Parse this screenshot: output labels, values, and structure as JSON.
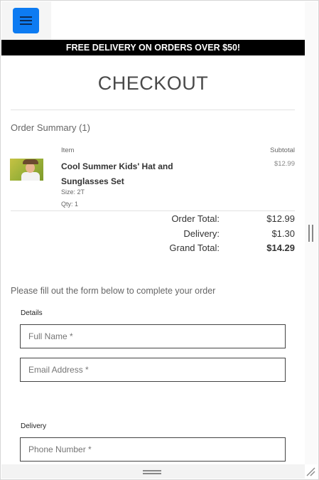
{
  "header": {
    "menu_icon": "hamburger-menu-icon",
    "promo_text": "FREE DELIVERY ON ORDERS OVER $50!",
    "accent_color": "#0d7bf2"
  },
  "page": {
    "title": "CHECKOUT"
  },
  "order_summary": {
    "title": "Order Summary (1)",
    "columns": {
      "item": "Item",
      "subtotal": "Subtotal"
    },
    "items": [
      {
        "name": "Cool Summer Kids' Hat and Sunglasses Set",
        "price": "$12.99",
        "size": "Size: 2T",
        "qty": "Qty: 1"
      }
    ],
    "totals": [
      {
        "label": "Order Total:",
        "value": "$12.99"
      },
      {
        "label": "Delivery:",
        "value": "$1.30"
      },
      {
        "label": "Grand Total:",
        "value": "$14.29"
      }
    ]
  },
  "form": {
    "instructions": "Please fill out the form below to complete your order",
    "details_label": "Details",
    "full_name_placeholder": "Full Name *",
    "email_placeholder": "Email Address *",
    "delivery_label": "Delivery",
    "phone_placeholder": "Phone Number *"
  }
}
